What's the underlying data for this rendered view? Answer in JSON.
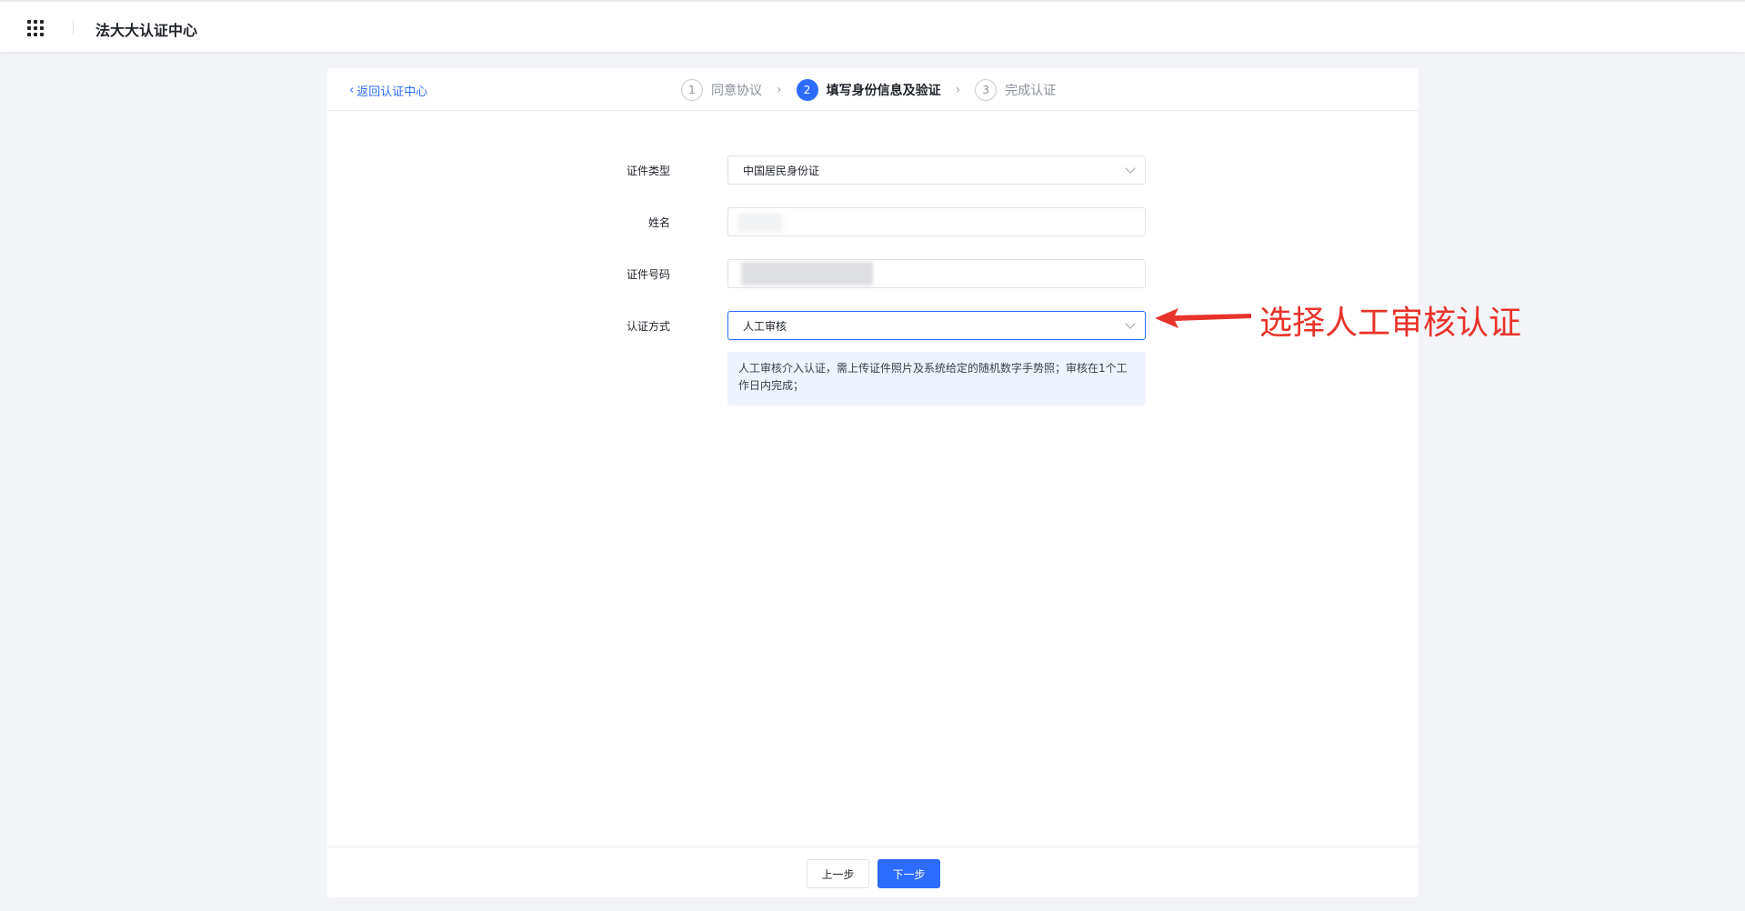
{
  "topbar": {
    "app_title": "法大大认证中心",
    "apps_icon": "grid-apps-icon"
  },
  "header": {
    "back_label": "返回认证中心",
    "steps": [
      {
        "number": "1",
        "label": "同意协议",
        "state": "done"
      },
      {
        "number": "2",
        "label": "填写身份信息及验证",
        "state": "active"
      },
      {
        "number": "3",
        "label": "完成认证",
        "state": "pending"
      }
    ]
  },
  "form": {
    "id_type": {
      "label": "证件类型",
      "value": "中国居民身份证"
    },
    "name": {
      "label": "姓名",
      "value": ""
    },
    "id_number": {
      "label": "证件号码",
      "value": ""
    },
    "auth_method": {
      "label": "认证方式",
      "value": "人工审核"
    },
    "hint": "人工审核介入认证，需上传证件照片及系统给定的随机数字手势照；审核在1个工作日内完成；"
  },
  "footer": {
    "prev_label": "上一步",
    "next_label": "下一步"
  },
  "annotation": {
    "text": "选择人工审核认证",
    "color": "#e8332a"
  },
  "colors": {
    "accent": "#2b6cff",
    "background": "#f3f4f7"
  }
}
